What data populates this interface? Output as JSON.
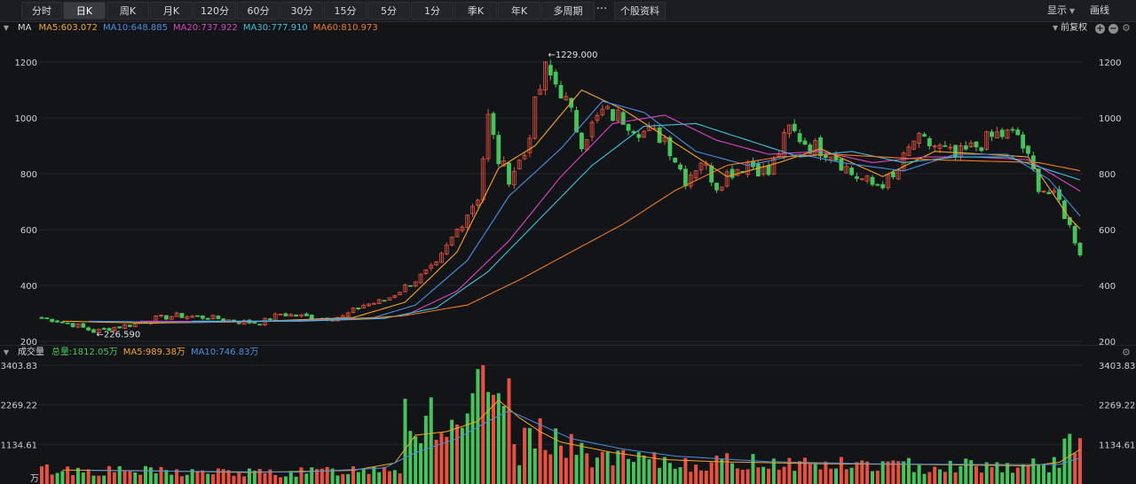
{
  "toolbar": {
    "periods": [
      "分时",
      "日K",
      "周K",
      "月K",
      "120分",
      "60分",
      "30分",
      "15分",
      "5分",
      "1分",
      "季K",
      "年K",
      "多周期"
    ],
    "active_period": "日K",
    "more_label": "···",
    "stock_info_label": "个股资料",
    "display_label": "显示",
    "draw_label": "画线"
  },
  "price_legend": {
    "label": "MA",
    "items": [
      {
        "text": "MA5:603.072",
        "color": "#f5a623"
      },
      {
        "text": "MA10:648.885",
        "color": "#4a90e2"
      },
      {
        "text": "MA20:737.922",
        "color": "#d946c2"
      },
      {
        "text": "MA30:777.910",
        "color": "#3fc1dc"
      },
      {
        "text": "MA60:810.973",
        "color": "#f07a22"
      }
    ],
    "adjust_label": "前复权"
  },
  "volume_legend": {
    "label": "成交量",
    "items": [
      {
        "text": "总量:1812.05万",
        "color": "#46c35a"
      },
      {
        "text": "MA5:989.38万",
        "color": "#f5a623"
      },
      {
        "text": "MA10:746.83万",
        "color": "#4a90e2"
      }
    ]
  },
  "colors": {
    "up": "#e8503f",
    "down": "#46c35a",
    "grid": "#24252b",
    "axis_text": "#d0d0d4"
  },
  "chart_data": [
    {
      "type": "candlestick",
      "title": "",
      "yticks": [
        200,
        400,
        600,
        800,
        1000,
        1200
      ],
      "ylim": [
        200,
        1270
      ],
      "xlim": [
        0,
        200
      ],
      "annotations": [
        {
          "label": "1229.000",
          "x": 97,
          "y": 1229
        },
        {
          "label": "226.590",
          "x": 10,
          "y": 226.59
        }
      ],
      "close_anchors": [
        [
          0,
          285
        ],
        [
          4,
          270
        ],
        [
          7,
          255
        ],
        [
          10,
          235
        ],
        [
          14,
          250
        ],
        [
          18,
          262
        ],
        [
          22,
          282
        ],
        [
          26,
          292
        ],
        [
          30,
          288
        ],
        [
          34,
          282
        ],
        [
          38,
          270
        ],
        [
          42,
          266
        ],
        [
          46,
          298
        ],
        [
          50,
          290
        ],
        [
          54,
          282
        ],
        [
          58,
          288
        ],
        [
          62,
          330
        ],
        [
          66,
          345
        ],
        [
          70,
          395
        ],
        [
          72,
          420
        ],
        [
          76,
          470
        ],
        [
          80,
          600
        ],
        [
          84,
          720
        ],
        [
          86,
          1000
        ],
        [
          88,
          850
        ],
        [
          90,
          790
        ],
        [
          93,
          870
        ],
        [
          95,
          1040
        ],
        [
          97,
          1170
        ],
        [
          100,
          1100
        ],
        [
          104,
          920
        ],
        [
          108,
          1020
        ],
        [
          112,
          1000
        ],
        [
          116,
          950
        ],
        [
          120,
          930
        ],
        [
          124,
          780
        ],
        [
          127,
          850
        ],
        [
          130,
          760
        ],
        [
          132,
          800
        ],
        [
          136,
          840
        ],
        [
          140,
          800
        ],
        [
          144,
          960
        ],
        [
          148,
          900
        ],
        [
          152,
          880
        ],
        [
          156,
          800
        ],
        [
          160,
          760
        ],
        [
          164,
          780
        ],
        [
          168,
          920
        ],
        [
          172,
          900
        ],
        [
          176,
          860
        ],
        [
          180,
          900
        ],
        [
          184,
          940
        ],
        [
          188,
          940
        ],
        [
          192,
          760
        ],
        [
          196,
          700
        ],
        [
          198,
          610
        ],
        [
          200,
          520
        ]
      ],
      "ma_anchors": {
        "MA5": [
          [
            4,
            272
          ],
          [
            20,
            265
          ],
          [
            40,
            270
          ],
          [
            60,
            285
          ],
          [
            70,
            340
          ],
          [
            80,
            520
          ],
          [
            88,
            820
          ],
          [
            95,
            900
          ],
          [
            104,
            1100
          ],
          [
            112,
            1030
          ],
          [
            122,
            910
          ],
          [
            132,
            790
          ],
          [
            142,
            840
          ],
          [
            150,
            890
          ],
          [
            162,
            790
          ],
          [
            172,
            880
          ],
          [
            182,
            870
          ],
          [
            190,
            860
          ],
          [
            198,
            640
          ],
          [
            200,
            603
          ]
        ],
        "MA10": [
          [
            9,
            272
          ],
          [
            30,
            268
          ],
          [
            50,
            275
          ],
          [
            64,
            285
          ],
          [
            72,
            330
          ],
          [
            82,
            490
          ],
          [
            90,
            720
          ],
          [
            100,
            890
          ],
          [
            108,
            1060
          ],
          [
            116,
            1020
          ],
          [
            126,
            880
          ],
          [
            136,
            830
          ],
          [
            146,
            870
          ],
          [
            154,
            840
          ],
          [
            166,
            810
          ],
          [
            176,
            870
          ],
          [
            186,
            870
          ],
          [
            194,
            780
          ],
          [
            200,
            649
          ]
        ],
        "MA20": [
          [
            19,
            272
          ],
          [
            40,
            270
          ],
          [
            60,
            278
          ],
          [
            70,
            292
          ],
          [
            80,
            380
          ],
          [
            90,
            560
          ],
          [
            100,
            790
          ],
          [
            110,
            980
          ],
          [
            120,
            1010
          ],
          [
            130,
            920
          ],
          [
            140,
            870
          ],
          [
            150,
            880
          ],
          [
            160,
            840
          ],
          [
            170,
            860
          ],
          [
            180,
            860
          ],
          [
            190,
            850
          ],
          [
            200,
            738
          ]
        ],
        "MA30": [
          [
            29,
            272
          ],
          [
            50,
            272
          ],
          [
            66,
            282
          ],
          [
            76,
            320
          ],
          [
            86,
            450
          ],
          [
            96,
            640
          ],
          [
            106,
            830
          ],
          [
            116,
            970
          ],
          [
            126,
            980
          ],
          [
            136,
            920
          ],
          [
            146,
            860
          ],
          [
            156,
            880
          ],
          [
            166,
            840
          ],
          [
            176,
            860
          ],
          [
            186,
            860
          ],
          [
            200,
            778
          ]
        ],
        "MA60": [
          [
            59,
            278
          ],
          [
            70,
            292
          ],
          [
            82,
            330
          ],
          [
            92,
            420
          ],
          [
            102,
            520
          ],
          [
            112,
            620
          ],
          [
            122,
            740
          ],
          [
            132,
            830
          ],
          [
            142,
            860
          ],
          [
            152,
            870
          ],
          [
            162,
            860
          ],
          [
            172,
            850
          ],
          [
            182,
            845
          ],
          [
            192,
            840
          ],
          [
            200,
            811
          ]
        ]
      }
    },
    {
      "type": "bar",
      "title": "",
      "unit_label": "万",
      "ytick_labels": [
        "3403.83",
        "2269.22",
        "1134.61"
      ],
      "yticks": [
        3403.83,
        2269.22,
        1134.61
      ],
      "ylim": [
        0,
        3403.83
      ],
      "volume_anchors": [
        [
          0,
          420
        ],
        [
          10,
          380
        ],
        [
          20,
          360
        ],
        [
          30,
          340
        ],
        [
          40,
          320
        ],
        [
          50,
          330
        ],
        [
          56,
          380
        ],
        [
          62,
          420
        ],
        [
          66,
          520
        ],
        [
          69,
          480
        ],
        [
          70,
          2200
        ],
        [
          72,
          1500
        ],
        [
          75,
          2100
        ],
        [
          78,
          1600
        ],
        [
          80,
          1200
        ],
        [
          83,
          2000
        ],
        [
          85,
          2900
        ],
        [
          86,
          3403
        ],
        [
          88,
          1800
        ],
        [
          90,
          2500
        ],
        [
          92,
          900
        ],
        [
          96,
          1800
        ],
        [
          100,
          1100
        ],
        [
          104,
          880
        ],
        [
          110,
          700
        ],
        [
          120,
          620
        ],
        [
          130,
          600
        ],
        [
          140,
          650
        ],
        [
          150,
          560
        ],
        [
          160,
          540
        ],
        [
          170,
          520
        ],
        [
          180,
          560
        ],
        [
          190,
          500
        ],
        [
          196,
          620
        ],
        [
          198,
          1180
        ],
        [
          200,
          1870
        ]
      ],
      "vol_ma5_anchors": [
        [
          4,
          400
        ],
        [
          20,
          380
        ],
        [
          40,
          330
        ],
        [
          60,
          390
        ],
        [
          68,
          600
        ],
        [
          72,
          1400
        ],
        [
          78,
          1500
        ],
        [
          84,
          1800
        ],
        [
          88,
          2400
        ],
        [
          92,
          1900
        ],
        [
          96,
          1500
        ],
        [
          100,
          1200
        ],
        [
          110,
          900
        ],
        [
          120,
          700
        ],
        [
          130,
          640
        ],
        [
          150,
          580
        ],
        [
          170,
          560
        ],
        [
          190,
          520
        ],
        [
          196,
          620
        ],
        [
          200,
          989
        ]
      ],
      "vol_ma10_anchors": [
        [
          9,
          390
        ],
        [
          30,
          360
        ],
        [
          50,
          340
        ],
        [
          66,
          460
        ],
        [
          72,
          900
        ],
        [
          80,
          1300
        ],
        [
          86,
          1800
        ],
        [
          90,
          2100
        ],
        [
          96,
          1700
        ],
        [
          102,
          1300
        ],
        [
          112,
          1000
        ],
        [
          122,
          800
        ],
        [
          140,
          640
        ],
        [
          160,
          580
        ],
        [
          180,
          560
        ],
        [
          196,
          560
        ],
        [
          200,
          747
        ]
      ]
    }
  ]
}
